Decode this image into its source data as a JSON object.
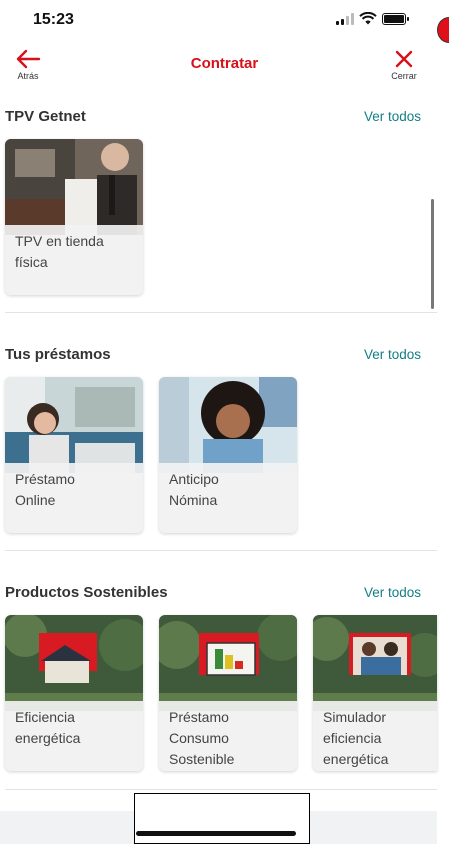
{
  "status_bar": {
    "time": "15:23"
  },
  "nav": {
    "back_label": "Atrás",
    "title": "Contratar",
    "close_label": "Cerrar"
  },
  "sections": [
    {
      "title": "TPV Getnet",
      "see_all": "Ver todos",
      "cards": [
        {
          "lines": [
            "TPV en tienda",
            "física"
          ]
        }
      ]
    },
    {
      "title": "Tus préstamos",
      "see_all": "Ver todos",
      "cards": [
        {
          "lines": [
            "Préstamo",
            "Online"
          ]
        },
        {
          "lines": [
            "Anticipo",
            "Nómina"
          ]
        }
      ]
    },
    {
      "title": "Productos Sostenibles",
      "see_all": "Ver todos",
      "cards": [
        {
          "lines": [
            "Eficiencia",
            "energética"
          ]
        },
        {
          "lines": [
            "Préstamo",
            "Consumo",
            "Sostenible"
          ]
        },
        {
          "lines": [
            "Simulador",
            "eficiencia",
            "energética"
          ]
        }
      ]
    }
  ],
  "colors": {
    "brand": "#d8101a",
    "link": "#137e84"
  }
}
